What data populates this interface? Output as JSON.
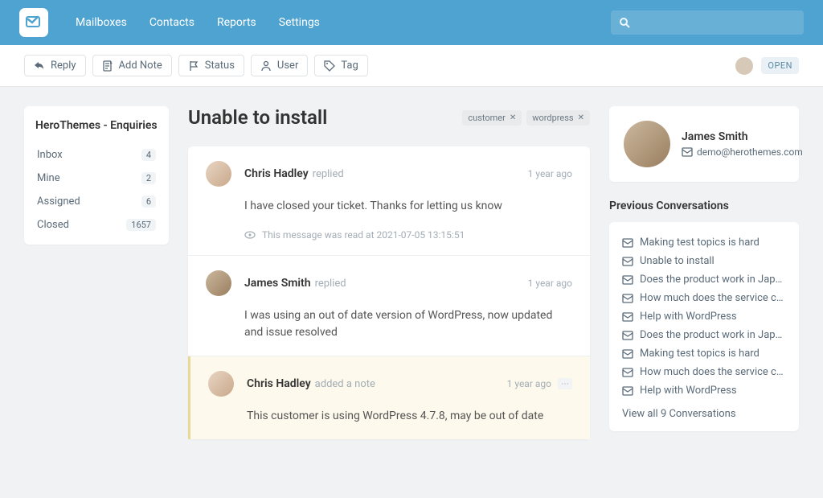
{
  "nav": {
    "items": [
      "Mailboxes",
      "Contacts",
      "Reports",
      "Settings"
    ]
  },
  "toolbar": {
    "reply": "Reply",
    "add_note": "Add Note",
    "status": "Status",
    "user": "User",
    "tag": "Tag",
    "badge": "OPEN"
  },
  "sidebar": {
    "title": "HeroThemes - Enquiries",
    "items": [
      {
        "label": "Inbox",
        "count": "4"
      },
      {
        "label": "Mine",
        "count": "2"
      },
      {
        "label": "Assigned",
        "count": "6"
      },
      {
        "label": "Closed",
        "count": "1657"
      }
    ]
  },
  "ticket": {
    "title": "Unable to install",
    "tags": [
      "customer",
      "wordpress"
    ]
  },
  "messages": [
    {
      "author": "Chris Hadley",
      "author_class": "chris",
      "action": "replied",
      "time": "1 year ago",
      "body": "I have closed your ticket. Thanks for letting us know",
      "read": "This message was read at 2021-07-05 13:15:51",
      "type": "reply"
    },
    {
      "author": "James Smith",
      "author_class": "james",
      "action": "replied",
      "time": "1 year ago",
      "body": "I was using an out of date version of WordPress, now updated and issue resolved",
      "type": "reply"
    },
    {
      "author": "Chris Hadley",
      "author_class": "chris",
      "action": "added a note",
      "time": "1 year ago",
      "body": "This customer is using WordPress 4.7.8, may be out of date",
      "type": "note",
      "more": true
    }
  ],
  "customer": {
    "name": "James Smith",
    "email": "demo@herothemes.com"
  },
  "previous": {
    "title": "Previous Conversations",
    "items": [
      "Making test topics is hard",
      "Unable to install",
      "Does the product work in Japanese?",
      "How much does the service cost",
      "Help with WordPress",
      "Does the product work in Japanese?",
      "Making test topics is hard",
      "How much does the service cost",
      "Help with WordPress"
    ],
    "view_all": "View all 9 Conversations"
  }
}
